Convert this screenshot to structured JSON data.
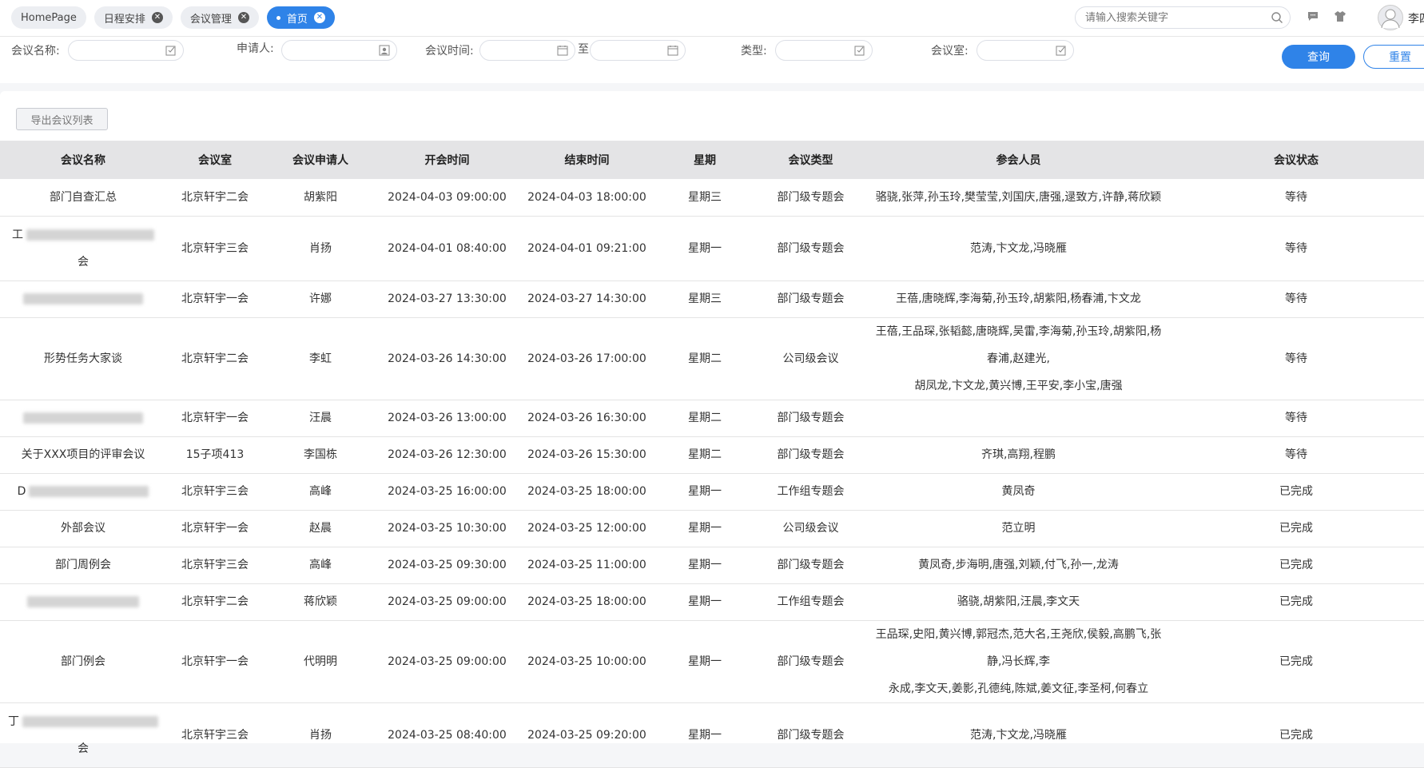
{
  "tabs": [
    {
      "label": "HomePage",
      "closable": false,
      "active": false
    },
    {
      "label": "日程安排",
      "closable": true,
      "active": false
    },
    {
      "label": "会议管理",
      "closable": true,
      "active": false
    },
    {
      "label": "首页",
      "closable": true,
      "active": true
    }
  ],
  "search": {
    "placeholder": "请输入搜索关键字"
  },
  "user": {
    "name": "李四"
  },
  "filters": {
    "meeting_name_label": "会议名称:",
    "applicant_label": "申请人:",
    "meeting_time_label": "会议时间:",
    "to_label": "至",
    "type_label": "类型:",
    "room_label": "会议室:",
    "query_button": "查询",
    "reset_button": "重置"
  },
  "toolbar": {
    "export_button": "导出会议列表"
  },
  "table": {
    "headers": [
      "会议名称",
      "会议室",
      "会议申请人",
      "开会时间",
      "结束时间",
      "星期",
      "会议类型",
      "参会人员",
      "会议状态"
    ],
    "rows": [
      {
        "name": "部门自查汇总",
        "room": "北京轩宇二会",
        "applicant": "胡紫阳",
        "start": "2024-04-03 09:00:00",
        "end": "2024-04-03 18:00:00",
        "weekday": "星期三",
        "type": "部门级专题会",
        "attendees_line1": "骆骁,张萍,孙玉玲,樊莹莹,刘国庆,唐强,逯致方,许静,蒋欣颖",
        "attendees_line2": "",
        "status": "等待"
      },
      {
        "name": "工",
        "name_tail": "会",
        "room": "北京轩宇三会",
        "applicant": "肖扬",
        "start": "2024-04-01 08:40:00",
        "end": "2024-04-01 09:21:00",
        "weekday": "星期一",
        "type": "部门级专题会",
        "attendees_line1": "范涛,卞文龙,冯晓雁",
        "attendees_line2": "",
        "status": "等待"
      },
      {
        "name": "",
        "room": "北京轩宇一会",
        "applicant": "许娜",
        "start": "2024-03-27 13:30:00",
        "end": "2024-03-27 14:30:00",
        "weekday": "星期三",
        "type": "部门级专题会",
        "attendees_line1": "王蓓,唐晓辉,李海菊,孙玉玲,胡紫阳,杨春浦,卞文龙",
        "attendees_line2": "",
        "status": "等待"
      },
      {
        "name": "形势任务大家谈",
        "room": "北京轩宇二会",
        "applicant": "李虹",
        "start": "2024-03-26 14:30:00",
        "end": "2024-03-26 17:00:00",
        "weekday": "星期二",
        "type": "公司级会议",
        "attendees_line1": "王蓓,王品琛,张韬懿,唐晓辉,吴雷,李海菊,孙玉玲,胡紫阳,杨春浦,赵建光,",
        "attendees_line2": "胡凤龙,卞文龙,黄兴博,王平安,李小宝,唐强",
        "status": "等待"
      },
      {
        "name": "",
        "room": "北京轩宇一会",
        "applicant": "汪晨",
        "start": "2024-03-26 13:00:00",
        "end": "2024-03-26 16:30:00",
        "weekday": "星期二",
        "type": "部门级专题会",
        "attendees_line1": "",
        "attendees_line2": "",
        "status": "等待"
      },
      {
        "name": "关于XXX项目的评审会议",
        "room": "15子项413",
        "applicant": "李国栋",
        "start": "2024-03-26 12:30:00",
        "end": "2024-03-26 15:30:00",
        "weekday": "星期二",
        "type": "部门级专题会",
        "attendees_line1": "齐琪,高翔,程鹏",
        "attendees_line2": "",
        "status": "等待"
      },
      {
        "name": "D",
        "room": "北京轩宇三会",
        "applicant": "高峰",
        "start": "2024-03-25 16:00:00",
        "end": "2024-03-25 18:00:00",
        "weekday": "星期一",
        "type": "工作组专题会",
        "attendees_line1": "黄凤奇",
        "attendees_line2": "",
        "status": "已完成"
      },
      {
        "name": "外部会议",
        "room": "北京轩宇一会",
        "applicant": "赵晨",
        "start": "2024-03-25 10:30:00",
        "end": "2024-03-25 12:00:00",
        "weekday": "星期一",
        "type": "公司级会议",
        "attendees_line1": "范立明",
        "attendees_line2": "",
        "status": "已完成"
      },
      {
        "name": "部门周例会",
        "room": "北京轩宇三会",
        "applicant": "高峰",
        "start": "2024-03-25 09:30:00",
        "end": "2024-03-25 11:00:00",
        "weekday": "星期一",
        "type": "部门级专题会",
        "attendees_line1": "黄凤奇,步海明,唐强,刘颖,付飞,孙一,龙涛",
        "attendees_line2": "",
        "status": "已完成"
      },
      {
        "name": "",
        "room": "北京轩宇二会",
        "applicant": "蒋欣颖",
        "start": "2024-03-25 09:00:00",
        "end": "2024-03-25 18:00:00",
        "weekday": "星期一",
        "type": "工作组专题会",
        "attendees_line1": "骆骁,胡紫阳,汪晨,李文天",
        "attendees_line2": "",
        "status": "已完成"
      },
      {
        "name": "部门例会",
        "room": "北京轩宇一会",
        "applicant": "代明明",
        "start": "2024-03-25 09:00:00",
        "end": "2024-03-25 10:00:00",
        "weekday": "星期一",
        "type": "部门级专题会",
        "attendees_line1": "王品琛,史阳,黄兴博,郭冠杰,范大名,王尧欣,侯毅,高鹏飞,张静,冯长辉,李",
        "attendees_line2": "永成,李文天,姜影,孔德纯,陈斌,姜文征,李圣柯,何春立",
        "status": "已完成"
      },
      {
        "name": "丁",
        "name_tail": "会",
        "room": "北京轩宇三会",
        "applicant": "肖扬",
        "start": "2024-03-25 08:40:00",
        "end": "2024-03-25 09:20:00",
        "weekday": "星期一",
        "type": "部门级专题会",
        "attendees_line1": "范涛,卞文龙,冯晓雁",
        "attendees_line2": "",
        "status": "已完成"
      }
    ]
  }
}
